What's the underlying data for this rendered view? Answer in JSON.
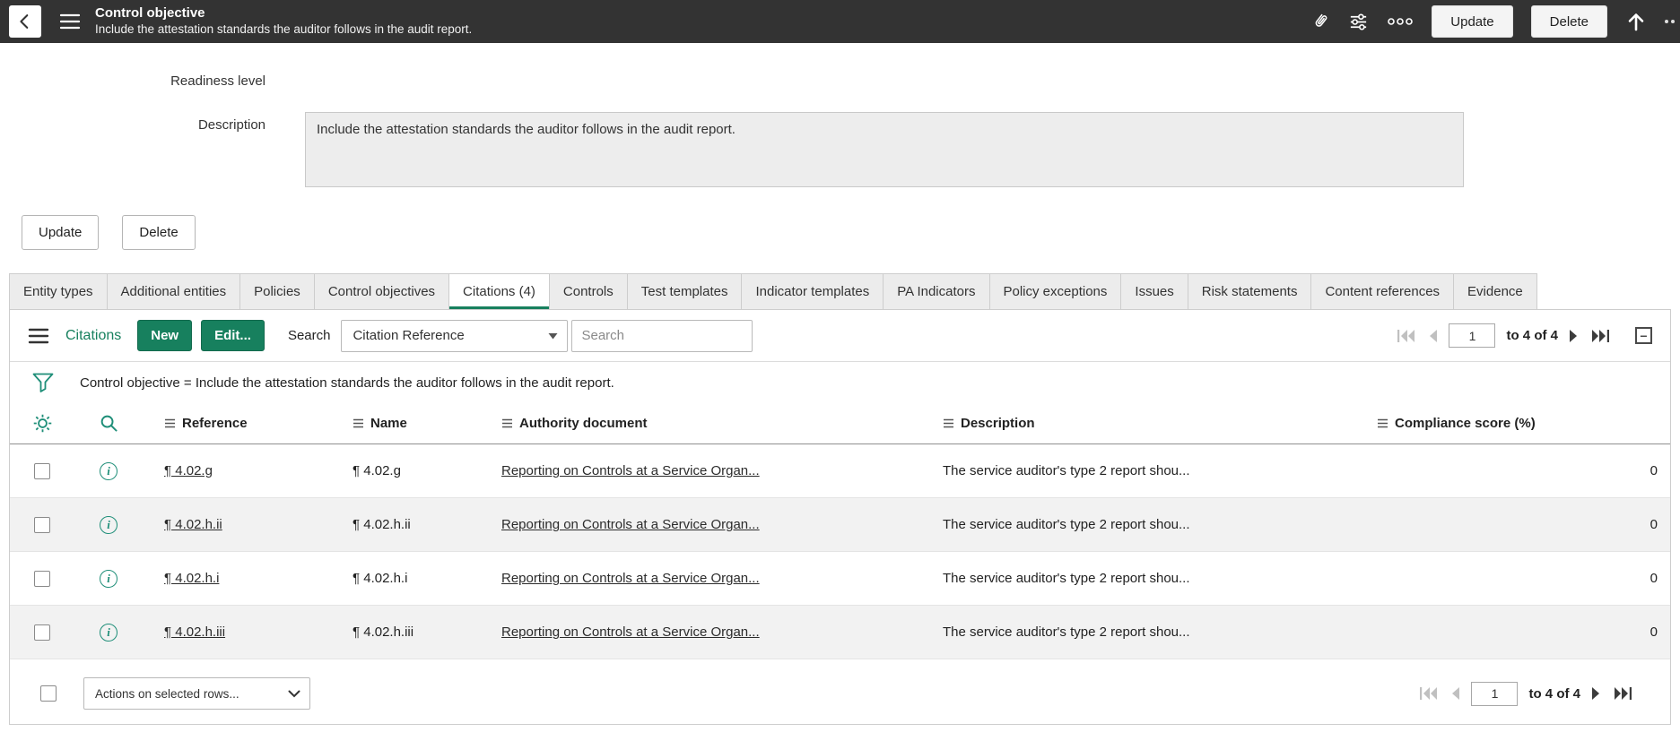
{
  "colors": {
    "topbar_bg": "#333333",
    "accent": "#17805E",
    "icon_teal": "#1E8E78",
    "row_alt_bg": "#F2F2F2"
  },
  "icons": {
    "info": "i",
    "collapse": "−"
  },
  "topbar": {
    "title": "Control objective",
    "subtitle": "Include the attestation standards the auditor follows in the audit report.",
    "update_label": "Update",
    "delete_label": "Delete"
  },
  "form": {
    "readiness_label": "Readiness level",
    "description_label": "Description",
    "description_value": "Include the attestation standards the auditor follows in the audit report.",
    "update_label": "Update",
    "delete_label": "Delete"
  },
  "tabs": [
    {
      "label": "Entity types"
    },
    {
      "label": "Additional entities"
    },
    {
      "label": "Policies"
    },
    {
      "label": "Control objectives"
    },
    {
      "label": "Citations (4)"
    },
    {
      "label": "Controls"
    },
    {
      "label": "Test templates"
    },
    {
      "label": "Indicator templates"
    },
    {
      "label": "PA Indicators"
    },
    {
      "label": "Policy exceptions"
    },
    {
      "label": "Issues"
    },
    {
      "label": "Risk statements"
    },
    {
      "label": "Content references"
    },
    {
      "label": "Evidence"
    }
  ],
  "citations": {
    "title": "Citations",
    "new_label": "New",
    "edit_label": "Edit...",
    "search_label": "Search",
    "search_field_selected": "Citation Reference",
    "search_placeholder": "Search",
    "filter_text": "Control objective = Include the attestation standards the auditor follows in the audit report.",
    "pagination": {
      "page": "1",
      "range": "to 4 of 4"
    },
    "columns": {
      "reference": "Reference",
      "name": "Name",
      "authority": "Authority document",
      "description": "Description",
      "score": "Compliance score (%)"
    },
    "rows": [
      {
        "reference": "¶ 4.02.g",
        "name": "¶ 4.02.g",
        "authority": "Reporting on Controls at a Service Organ...",
        "description": "The service auditor's type 2 report shou...",
        "score": "0"
      },
      {
        "reference": "¶ 4.02.h.ii",
        "name": "¶ 4.02.h.ii",
        "authority": "Reporting on Controls at a Service Organ...",
        "description": "The service auditor's type 2 report shou...",
        "score": "0"
      },
      {
        "reference": "¶ 4.02.h.i",
        "name": "¶ 4.02.h.i",
        "authority": "Reporting on Controls at a Service Organ...",
        "description": "The service auditor's type 2 report shou...",
        "score": "0"
      },
      {
        "reference": "¶ 4.02.h.iii",
        "name": "¶ 4.02.h.iii",
        "authority": "Reporting on Controls at a Service Organ...",
        "description": "The service auditor's type 2 report shou...",
        "score": "0"
      }
    ],
    "actions_label": "Actions on selected rows..."
  }
}
